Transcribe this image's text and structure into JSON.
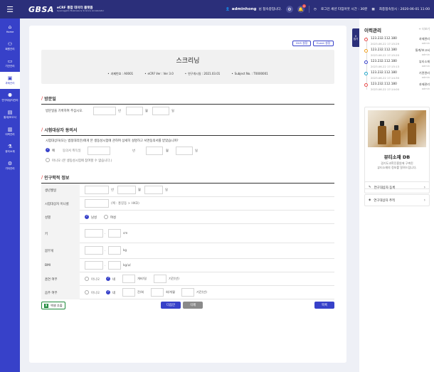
{
  "topbar": {
    "logo": "GBSA",
    "logo_sub1": "eCRF 통합 데이터 플랫폼",
    "logo_sub2": "Gyeonggido Business & Science Accelerator",
    "username": "adminhong",
    "greeting": "님 접속중입니다.",
    "notif_count": "0",
    "session_text": "로그인 세션 타임아웃 시간 : 30분",
    "last_login": "최종접속일시 : 2020-06-01 11:00"
  },
  "nav": [
    {
      "label": "Home",
      "icon": "home-icon"
    },
    {
      "label": "회원관리",
      "icon": "user-icon"
    },
    {
      "label": "기관관리",
      "icon": "monitor-icon"
    },
    {
      "label": "과제관리",
      "icon": "folder-icon"
    },
    {
      "label": "연구대상자관리",
      "icon": "people-icon"
    },
    {
      "label": "통계/보고서",
      "icon": "chart-icon"
    },
    {
      "label": "이력관리",
      "icon": "history-icon"
    },
    {
      "label": "뷰티소재",
      "icon": "flask-icon"
    },
    {
      "label": "기타관리",
      "icon": "etc-icon"
    }
  ],
  "card": {
    "dvs_btn": "DVS 설정",
    "event_btn": "Event 설정",
    "title": "스크리닝",
    "info": [
      "과제번호 : A0001",
      "eCRF Ver : Ver 3.0",
      "연구개시일 : 2021.03.01",
      "Subject No. : T0000001"
    ]
  },
  "visit": {
    "title": "방문일",
    "prompt": "방문일을 기록하여 주십시오.",
    "u_year": "년",
    "u_month": "월",
    "u_day": "일"
  },
  "consent": {
    "title": "시험대상자 동의서",
    "question": "시험대상자(또는 법정대리인)에게 본 생동성시험에 관하여 상세히 설명하고 서면동의서를 받았습니까?",
    "yes": "예",
    "yes_date_label": "동의서 취득일",
    "no": "아니오 (본 생동성시험에 참여할 수 없습니다.)",
    "u_year": "년",
    "u_month": "월",
    "u_day": "일"
  },
  "demo": {
    "title": "인구학적 정보",
    "rows": {
      "birth": "생년월일",
      "initial": "시험대상자 이니셜",
      "initial_hint": "(예 : 홍길동 > HKD)",
      "sex": "성별",
      "male": "남성",
      "female": "여성",
      "height": "키",
      "height_unit": "cm",
      "weight": "몸무게",
      "weight_unit": "kg",
      "bmi": "BMI",
      "bmi_unit": "kg/㎡",
      "smoke": "흡연 여부",
      "no": "아니오",
      "yes": "네",
      "smoke_unit1": "개비/일",
      "smoke_unit2": "기간(년)",
      "drink": "음주 여부",
      "drink_unit1": "잔/회",
      "drink_unit2": "회/개월",
      "drink_unit3": "기간(년)",
      "u_year": "년",
      "u_month": "월",
      "u_day": "일"
    }
  },
  "actions": {
    "excel": "엑셀 추출",
    "save": "다음안",
    "delete": "삭제",
    "list": "목록"
  },
  "right": {
    "fold": "접기",
    "title": "이력관리",
    "more": "+ 더보기",
    "history": [
      {
        "ip": "123.232.112.180",
        "time": "2023.06.22 17:15:29",
        "action": "과제관리",
        "by": "admin"
      },
      {
        "ip": "123.232.112.180",
        "time": "2023.06.22 17:15:20",
        "action": "통계/보고서",
        "by": "admin"
      },
      {
        "ip": "123.232.112.180",
        "time": "2023.06.22 17:15:13",
        "action": "뷰티소재",
        "by": "admin"
      },
      {
        "ip": "123.232.112.180",
        "time": "2023.06.22 17:14:30",
        "action": "기관관리",
        "by": "admin"
      },
      {
        "ip": "123.232.112.180",
        "time": "2023.06.22 17:14:00",
        "action": "과제관리",
        "by": "admin"
      }
    ],
    "history_colors": [
      "#e84c4c",
      "#f0a020",
      "#3741c9",
      "#26a7c9",
      "#e84c4c"
    ],
    "promo_title": "뷰티소재 DB",
    "promo_desc1": "경기도과학진흥원에 구축된",
    "promo_desc2": "뷰티소재의 정보를 알려드립니다.",
    "link1": "연구대상자 등록",
    "link2": "연구대상자 추적"
  },
  "colors": {
    "brand": "#2b2f7a",
    "accent": "#3741c9",
    "danger": "#e84c4c"
  }
}
